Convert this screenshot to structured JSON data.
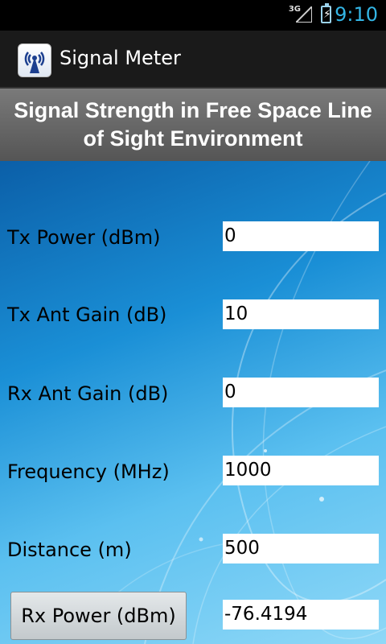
{
  "status_bar": {
    "network": "3G",
    "time": "9:10",
    "accent": "#33b5e5"
  },
  "action_bar": {
    "title": "Signal Meter",
    "icon": "antenna-icon"
  },
  "header": {
    "title": "Signal Strength in Free Space Line of Sight Environment"
  },
  "form": {
    "tx_power": {
      "label": "Tx Power (dBm)",
      "value": "0"
    },
    "tx_ant_gain": {
      "label": "Tx Ant Gain (dB)",
      "value": "10"
    },
    "rx_ant_gain": {
      "label": "Rx Ant Gain (dB)",
      "value": "0"
    },
    "frequency": {
      "label": "Frequency (MHz)",
      "value": "1000"
    },
    "distance": {
      "label": "Distance (m)",
      "value": "500"
    }
  },
  "result": {
    "button_label": "Rx Power (dBm)",
    "value": "-76.4194"
  }
}
